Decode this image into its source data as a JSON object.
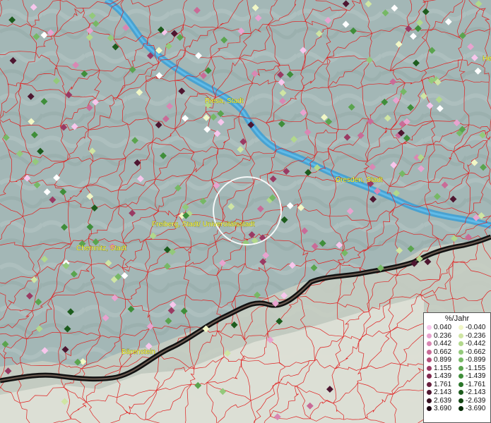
{
  "map": {
    "places": [
      {
        "id": "riesa",
        "name": "Riesa, Stadt"
      },
      {
        "id": "dresden",
        "name": "Dresden, Stadt"
      },
      {
        "id": "freiberg",
        "name": "Freiberg, Stadt/ Universitätsstadt"
      },
      {
        "id": "chemnitz",
        "name": "Chemnitz, Stadt"
      },
      {
        "id": "baerenstein",
        "name": "Bärenstein"
      },
      {
        "id": "edge",
        "name": "He"
      }
    ],
    "colors": {
      "terrain": "#9fb3b3",
      "river": "#3a9fd6",
      "borders": "#e02020",
      "border_line": "#111111",
      "mountains": "#d9dccf"
    }
  },
  "legend": {
    "title": "%/Jahr",
    "positive": [
      "0.040",
      "0.236",
      "0.442",
      "0.662",
      "0.899",
      "1.155",
      "1.439",
      "1.761",
      "2.143",
      "2.639",
      "3.690"
    ],
    "negative": [
      "-0.040",
      "-0.236",
      "-0.442",
      "-0.662",
      "-0.899",
      "-1.155",
      "-1.439",
      "-1.761",
      "-2.143",
      "-2.639",
      "-3.690"
    ],
    "positive_colors": [
      "#f7c6ec",
      "#e8a3cf",
      "#d987b3",
      "#c96b97",
      "#b4507b",
      "#9a3a63",
      "#80294f",
      "#68203e",
      "#4e1630",
      "#361020",
      "#1a0610"
    ],
    "negative_colors": [
      "#f1f7c6",
      "#cfe5a3",
      "#b2d88c",
      "#93c97b",
      "#76b865",
      "#5aa44e",
      "#3f8e3a",
      "#2a7529",
      "#1d5c1d",
      "#124612",
      "#072c07"
    ]
  }
}
